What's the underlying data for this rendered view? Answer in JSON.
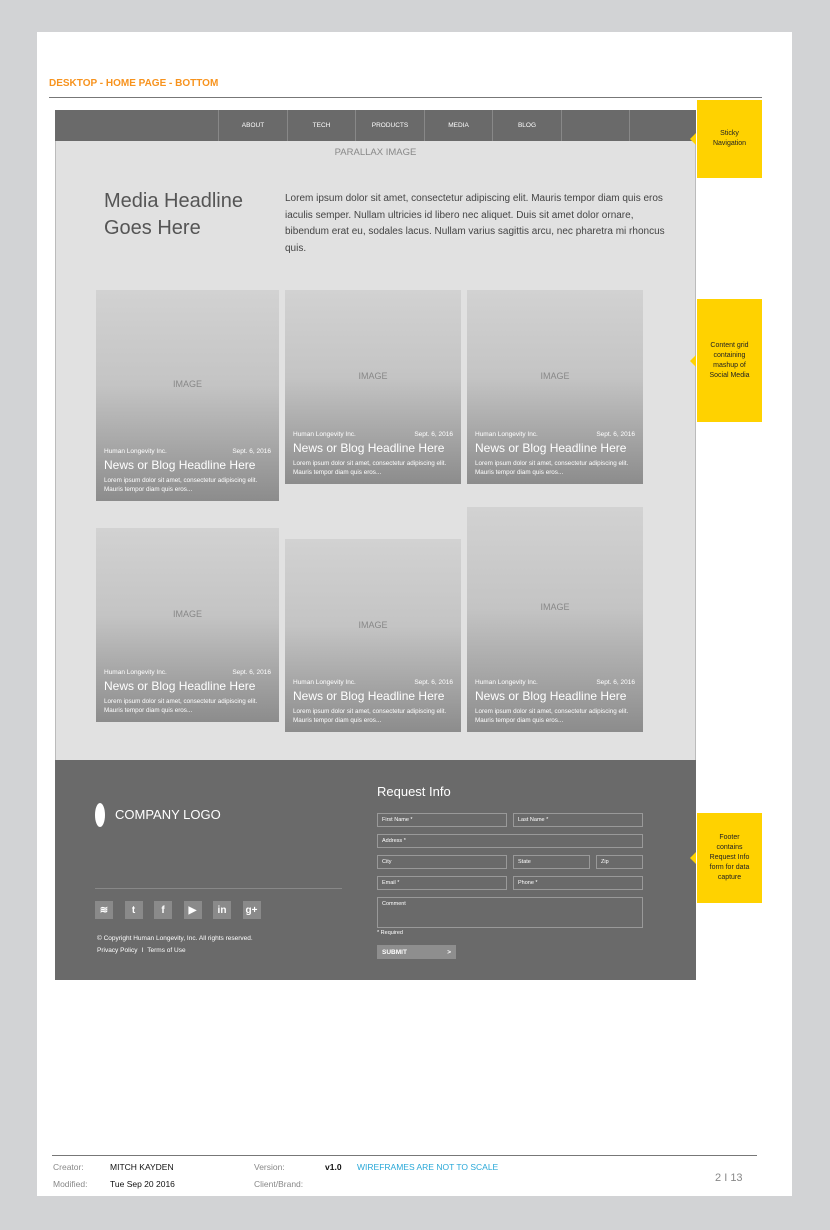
{
  "page_title": "DESKTOP - HOME PAGE - BOTTOM",
  "nav": {
    "items": [
      "ABOUT",
      "TECH",
      "PRODUCTS",
      "MEDIA",
      "BLOG",
      "",
      ""
    ]
  },
  "parallax_label": "PARALLAX IMAGE",
  "media": {
    "headline": "Media Headline Goes Here",
    "body": "Lorem ipsum dolor sit amet, consectetur adipiscing elit. Mauris tempor diam quis eros iaculis semper. Nullam ultricies id libero nec aliquet. Duis sit amet dolor ornare, bibendum erat eu, sodales lacus. Nullam varius sagittis arcu, nec pharetra mi rhoncus quis."
  },
  "cards": [
    {
      "image": "IMAGE",
      "source": "Human Longevity Inc.",
      "date": "Sept. 6, 2016",
      "headline": "News or Blog Headline Here",
      "excerpt": "Lorem ipsum dolor sit amet, consectetur adipiscing elit. Mauris tempor diam quis eros..."
    },
    {
      "image": "IMAGE",
      "source": "Human Longevity Inc.",
      "date": "Sept. 6, 2016",
      "headline": "News or Blog Headline Here",
      "excerpt": "Lorem ipsum dolor sit amet, consectetur adipiscing elit. Mauris tempor diam quis eros..."
    },
    {
      "image": "IMAGE",
      "source": "Human Longevity Inc.",
      "date": "Sept. 6, 2016",
      "headline": "News or Blog Headline Here",
      "excerpt": "Lorem ipsum dolor sit amet, consectetur adipiscing elit. Mauris tempor diam quis eros..."
    },
    {
      "image": "IMAGE",
      "source": "Human Longevity Inc.",
      "date": "Sept. 6, 2016",
      "headline": "News or Blog Headline Here",
      "excerpt": "Lorem ipsum dolor sit amet, consectetur adipiscing elit. Mauris tempor diam quis eros..."
    },
    {
      "image": "IMAGE",
      "source": "Human Longevity Inc.",
      "date": "Sept. 6, 2016",
      "headline": "News or Blog Headline Here",
      "excerpt": "Lorem ipsum dolor sit amet, consectetur adipiscing elit. Mauris tempor diam quis eros..."
    },
    {
      "image": "IMAGE",
      "source": "Human Longevity Inc.",
      "date": "Sept. 6, 2016",
      "headline": "News or Blog Headline Here",
      "excerpt": "Lorem ipsum dolor sit amet, consectetur adipiscing elit. Mauris tempor diam quis eros..."
    }
  ],
  "footer": {
    "logo": "COMPANY LOGO",
    "social_icons": [
      "rss-icon",
      "twitter-icon",
      "facebook-icon",
      "youtube-icon",
      "linkedin-icon",
      "google-plus-icon"
    ],
    "social_glyphs": [
      "≋",
      "t",
      "f",
      "▶",
      "in",
      "g+"
    ],
    "copyright": "© Copyright Human Longevity, Inc. All rights reserved.",
    "privacy": "Privacy Policy",
    "sep": "I",
    "terms": "Terms of Use"
  },
  "form": {
    "title": "Request Info",
    "first_name": "First Name *",
    "last_name": "Last Name *",
    "address": "Address *",
    "city": "City",
    "state": "State",
    "zip": "Zip",
    "email": "Email *",
    "phone": "Phone *",
    "comment": "Comment",
    "required": "* Required",
    "submit": "SUBMIT",
    "submit_arrow": ">"
  },
  "annotations": [
    "Sticky Navigation",
    "Content grid containing mashup of Social Media",
    "Footer contains Request Info form for data capture"
  ],
  "annotation_color": "#ffd200",
  "meta": {
    "creator_label": "Creator:",
    "creator": "MITCH KAYDEN",
    "modified_label": "Modified:",
    "modified": "Tue Sep 20 2016",
    "version_label": "Version:",
    "version": "v1.0",
    "notice": "WIREFRAMES ARE NOT TO SCALE",
    "client_label": "Client/Brand:",
    "page": "2",
    "page_sep": "I",
    "total": "13"
  }
}
